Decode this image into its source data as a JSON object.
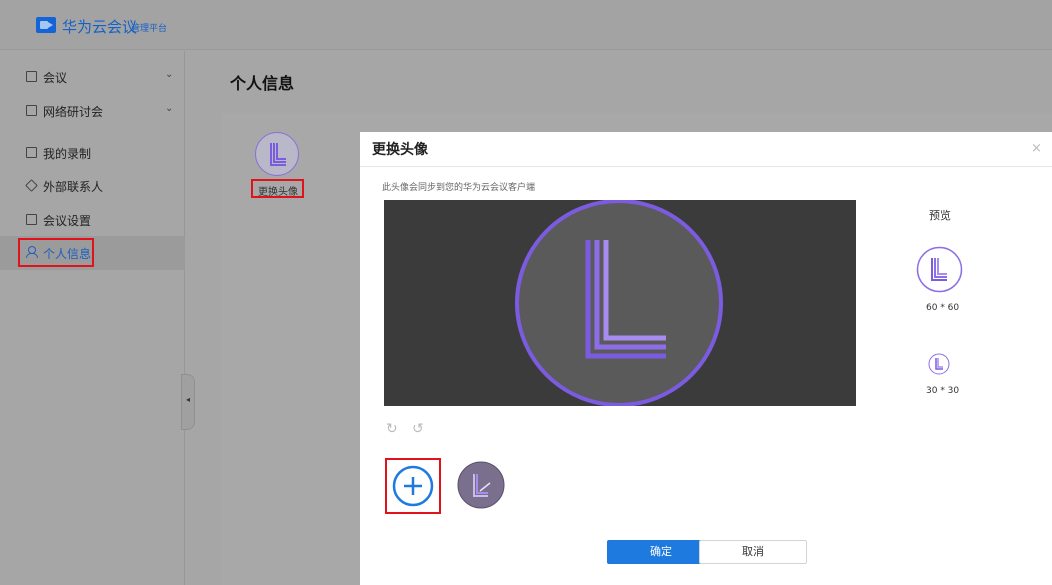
{
  "header": {
    "brand": "华为云会议",
    "subtitle": "管理平台"
  },
  "sidebar": {
    "items": [
      {
        "label": "会议",
        "icon": "calendar-icon",
        "has_chevron": true
      },
      {
        "label": "网络研讨会",
        "icon": "webinar-icon",
        "has_chevron": true
      },
      {
        "label": "我的录制",
        "icon": "recording-icon",
        "has_chevron": false
      },
      {
        "label": "外部联系人",
        "icon": "contacts-icon",
        "has_chevron": false
      },
      {
        "label": "会议设置",
        "icon": "settings-icon",
        "has_chevron": false
      },
      {
        "label": "个人信息",
        "icon": "person-icon",
        "has_chevron": false,
        "active": true
      }
    ],
    "chevron": "⌄",
    "collapse_glyph": "◂"
  },
  "main": {
    "page_title": "个人信息",
    "change_avatar_label": "更换头像"
  },
  "dialog": {
    "title": "更换头像",
    "close_glyph": "×",
    "hint": "此头像会同步到您的华为云会议客户端",
    "preview_title": "预览",
    "preview_large_label": "60 * 60",
    "preview_small_label": "30 * 30",
    "rotate_left_glyph": "↻",
    "rotate_right_glyph": "↺",
    "ok_label": "确定",
    "cancel_label": "取消"
  },
  "colors": {
    "accent": "#1f7ae0",
    "brand": "#1661c7",
    "highlight_outline": "#e0121c",
    "avatar_purple": "#7b5ce0"
  }
}
